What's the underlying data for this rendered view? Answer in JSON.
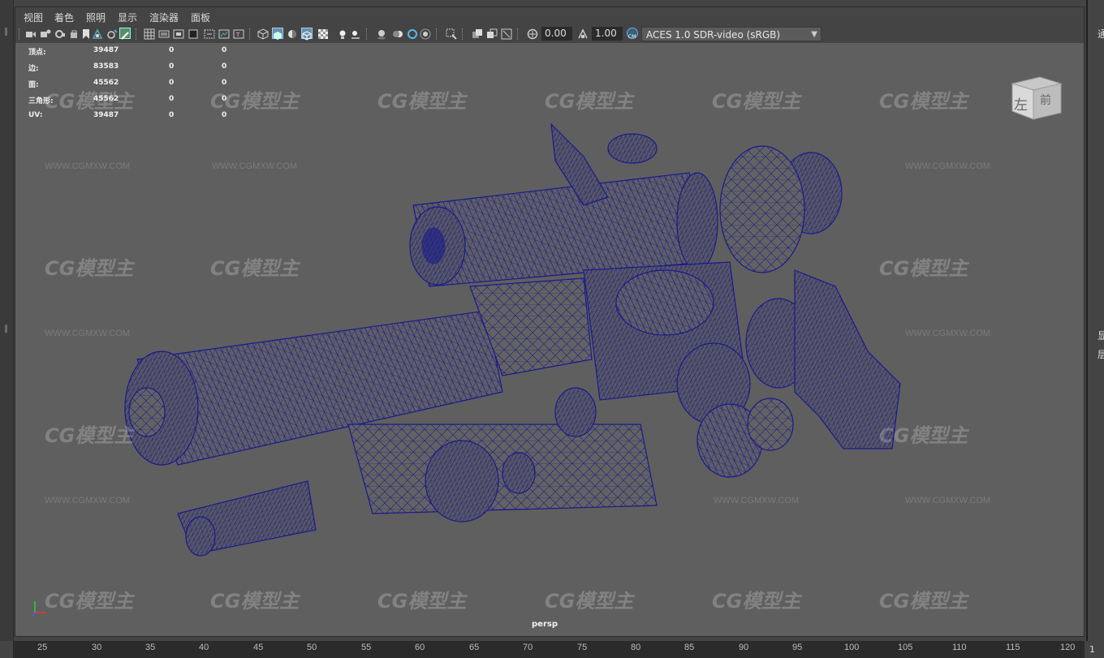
{
  "menu": [
    "视图",
    "着色",
    "照明",
    "显示",
    "渲染器",
    "面板"
  ],
  "toolbar": {
    "exposure_value": "0.00",
    "gamma_value": "1.00",
    "color_transform": "ACES 1.0 SDR-video (sRGB)",
    "icons": [
      "camera-select-icon",
      "camera-attributes-icon",
      "bookmark-icon",
      "image-plane-icon",
      "grid-icon",
      "film-gate-icon",
      "resolution-gate-icon",
      "gate-mask-icon",
      "field-chart-icon",
      "safe-action-icon",
      "wireframe-icon",
      "smooth-shade-icon",
      "default-material-icon",
      "textured-icon",
      "lighting-icon",
      "shadows-icon",
      "xray-icon",
      "isolate-select-icon",
      "exposure-icon",
      "gamma-icon",
      "color-management-icon"
    ]
  },
  "hud": {
    "rows": [
      {
        "label": "顶点:",
        "total": "39487",
        "selected": "0",
        "other": "0"
      },
      {
        "label": "边:",
        "total": "83583",
        "selected": "0",
        "other": "0"
      },
      {
        "label": "面:",
        "total": "45562",
        "selected": "0",
        "other": "0"
      },
      {
        "label": "三角形:",
        "total": "45562",
        "selected": "0",
        "other": "0"
      },
      {
        "label": "UV:",
        "total": "39487",
        "selected": "0",
        "other": "0"
      }
    ]
  },
  "viewport": {
    "camera_label": "persp",
    "viewcube_labels": [
      "左",
      "前"
    ],
    "watermark_logo": "CG模型主",
    "watermark_url": "WWW.CGMXW.COM",
    "wireframe_color": "#1a1a8c"
  },
  "right_panel": {
    "texts": [
      "通",
      "显",
      "层"
    ],
    "corner": "1"
  },
  "timeline": {
    "ticks": [
      "25",
      "30",
      "35",
      "40",
      "45",
      "50",
      "55",
      "60",
      "65",
      "70",
      "75",
      "80",
      "85",
      "90",
      "95",
      "100",
      "105",
      "110",
      "115",
      "120"
    ]
  }
}
